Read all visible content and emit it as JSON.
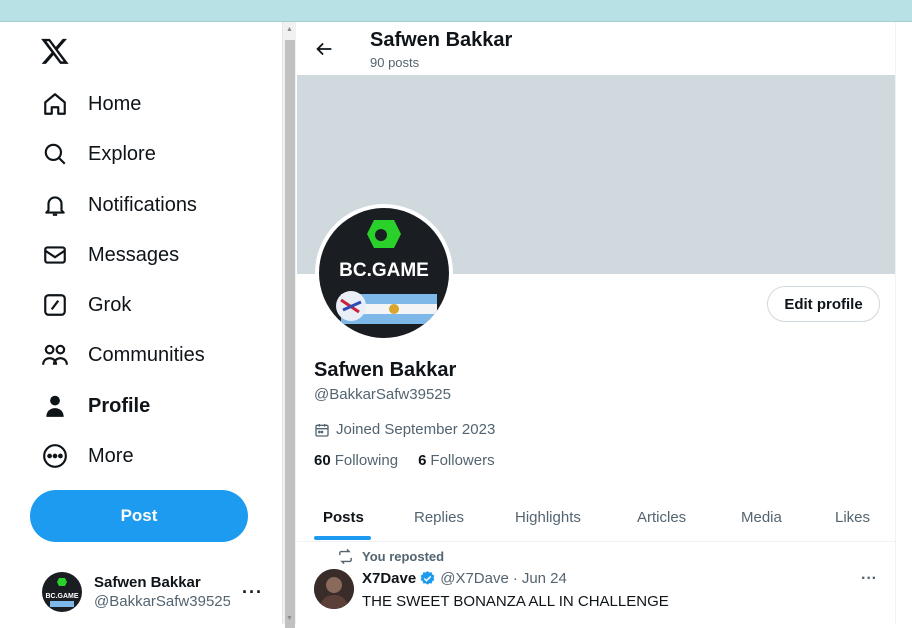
{
  "sidebar": {
    "logo": "x-logo-icon",
    "items": [
      {
        "label": "Home",
        "icon": "home-icon"
      },
      {
        "label": "Explore",
        "icon": "search-icon"
      },
      {
        "label": "Notifications",
        "icon": "bell-icon"
      },
      {
        "label": "Messages",
        "icon": "envelope-icon"
      },
      {
        "label": "Grok",
        "icon": "grok-icon"
      },
      {
        "label": "Communities",
        "icon": "communities-icon"
      },
      {
        "label": "Profile",
        "icon": "person-icon",
        "active": true
      },
      {
        "label": "More",
        "icon": "more-circle-icon"
      }
    ],
    "post_label": "Post",
    "account": {
      "name": "Safwen Bakkar",
      "handle": "@BakkarSafw39525"
    }
  },
  "header": {
    "title": "Safwen Bakkar",
    "subtitle": "90 posts"
  },
  "profile": {
    "avatar_text": "BC.GAME",
    "edit_label": "Edit profile",
    "name": "Safwen Bakkar",
    "handle": "@BakkarSafw39525",
    "joined": "Joined September 2023",
    "following_count": "60",
    "following_label": "Following",
    "followers_count": "6",
    "followers_label": "Followers"
  },
  "tabs": [
    "Posts",
    "Replies",
    "Highlights",
    "Articles",
    "Media",
    "Likes"
  ],
  "tweet": {
    "repost_label": "You reposted",
    "name": "X7Dave",
    "handle": "@X7Dave",
    "date": "Jun 24",
    "text": "THE SWEET BONANZA ALL IN CHALLENGE"
  },
  "colors": {
    "accent": "#1d9bf0",
    "banner": "#cfd9de",
    "browser_bar": "#b7e1e4"
  }
}
